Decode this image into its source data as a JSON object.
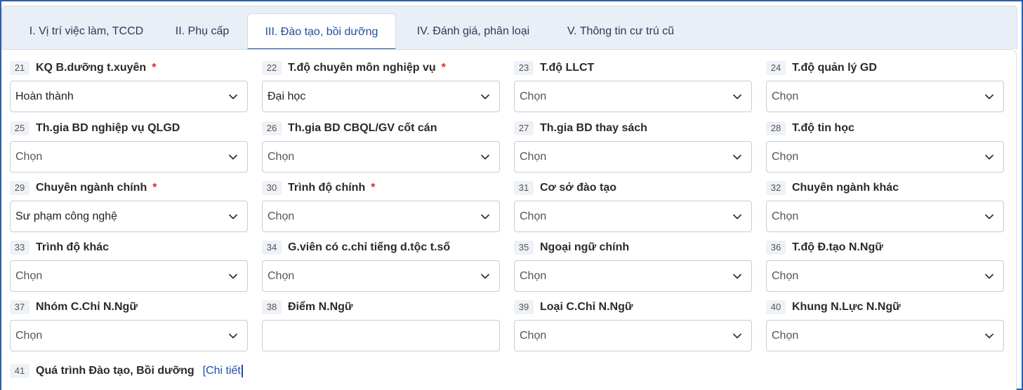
{
  "tabs": [
    {
      "label": "I. Vị trí việc làm, TCCD"
    },
    {
      "label": "II. Phụ cấp"
    },
    {
      "label": "III. Đào tạo, bồi dưỡng"
    },
    {
      "label": "IV. Đánh giá, phân loại"
    },
    {
      "label": "V. Thông tin cư trú cũ"
    }
  ],
  "active_tab": "III. Đào tạo, bồi dưỡng",
  "fields": [
    {
      "num": "21",
      "label": "KQ B.dưỡng t.xuyên",
      "required": "*",
      "value": "Hoàn thành"
    },
    {
      "num": "22",
      "label": "T.độ chuyên môn nghiệp vụ",
      "required": "*",
      "value": "Đại học"
    },
    {
      "num": "23",
      "label": "T.độ LLCT",
      "value": "Chọn"
    },
    {
      "num": "24",
      "label": "T.độ quản lý GD",
      "value": "Chọn"
    },
    {
      "num": "25",
      "label": "Th.gia BD nghiệp vụ QLGD",
      "value": "Chọn"
    },
    {
      "num": "26",
      "label": "Th.gia BD CBQL/GV cốt cán",
      "value": "Chọn"
    },
    {
      "num": "27",
      "label": "Th.gia BD thay sách",
      "value": "Chọn"
    },
    {
      "num": "28",
      "label": "T.độ tin học",
      "value": "Chọn"
    },
    {
      "num": "29",
      "label": "Chuyên ngành chính",
      "required": "*",
      "value": "Sư phạm công nghệ"
    },
    {
      "num": "30",
      "label": "Trình độ chính",
      "required": "*",
      "value": "Chọn"
    },
    {
      "num": "31",
      "label": "Cơ sở đào tạo",
      "value": "Chọn"
    },
    {
      "num": "32",
      "label": "Chuyên ngành khác",
      "value": "Chọn"
    },
    {
      "num": "33",
      "label": "Trình độ khác",
      "value": "Chọn"
    },
    {
      "num": "34",
      "label": "G.viên có c.chỉ tiếng d.tộc t.số",
      "value": "Chọn"
    },
    {
      "num": "35",
      "label": "Ngoại ngữ chính",
      "value": "Chọn"
    },
    {
      "num": "36",
      "label": "T.độ Đ.tạo N.Ngữ",
      "value": "Chọn"
    },
    {
      "num": "37",
      "label": "Nhóm C.Chỉ N.Ngữ",
      "value": "Chọn"
    },
    {
      "num": "38",
      "label": "Điểm N.Ngữ",
      "value": ""
    },
    {
      "num": "39",
      "label": "Loại C.Chỉ N.Ngữ",
      "value": "Chọn"
    },
    {
      "num": "40",
      "label": "Khung N.Lực N.Ngữ",
      "value": "Chọn"
    }
  ],
  "detail": {
    "num": "41",
    "label": "Quá trình Đào tạo, Bồi dưỡng",
    "link": "[Chi tiết"
  },
  "colors": {
    "accent": "#1f4e9c",
    "required": "#e02424",
    "border": "#2b5fae"
  }
}
